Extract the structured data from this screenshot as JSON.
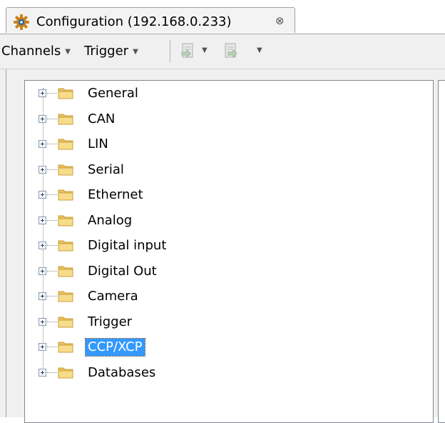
{
  "tab": {
    "title": "Configuration (192.168.0.233)",
    "close_glyph": "⊗",
    "icon": "gear-icon"
  },
  "toolbar": {
    "channels_label": "Channels",
    "trigger_label": "Trigger",
    "dropdown_glyph": "▼",
    "import_icon": "import-icon",
    "export_icon": "export-icon"
  },
  "tree": {
    "selected_color": "#3399ff",
    "items": [
      {
        "label": "General",
        "selected": false
      },
      {
        "label": "CAN",
        "selected": false
      },
      {
        "label": "LIN",
        "selected": false
      },
      {
        "label": "Serial",
        "selected": false
      },
      {
        "label": "Ethernet",
        "selected": false
      },
      {
        "label": "Analog",
        "selected": false
      },
      {
        "label": "Digital input",
        "selected": false
      },
      {
        "label": "Digital Out",
        "selected": false
      },
      {
        "label": "Camera",
        "selected": false
      },
      {
        "label": "Trigger",
        "selected": false
      },
      {
        "label": "CCP/XCP",
        "selected": true
      },
      {
        "label": "Databases",
        "selected": false
      }
    ]
  }
}
